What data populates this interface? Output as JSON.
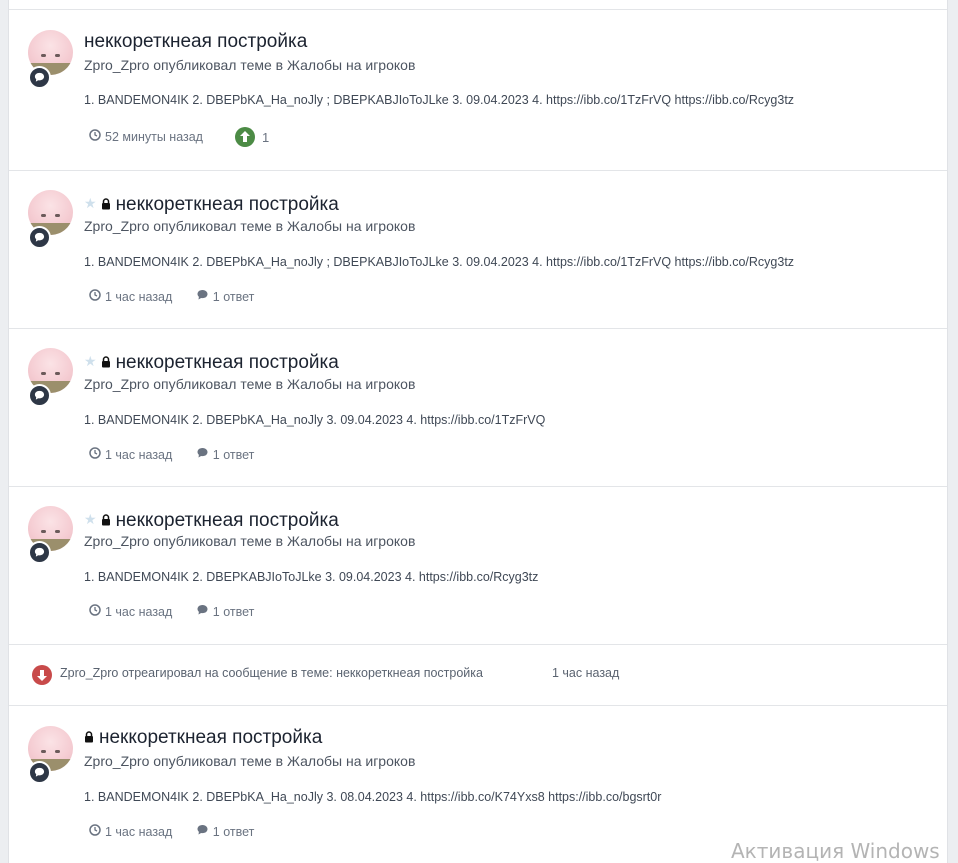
{
  "posts": [
    {
      "title": "неккореткнеая постройка",
      "starred": false,
      "locked": false,
      "meta": "Zpro_Zpro опубликовал теме в Жалобы на игроков",
      "content": "1. BANDEMON4IK 2. DBEPbKA_Ha_noJly ; DBEPKABJIoToJLke 3. 09.04.2023 4. https://ibb.co/1TzFrVQ https://ibb.co/Rcyg3tz",
      "time": "52 минуты назад",
      "reputation": "1"
    },
    {
      "title": "неккореткнеая постройка",
      "starred": true,
      "locked": true,
      "meta": "Zpro_Zpro опубликовал теме в Жалобы на игроков",
      "content": "1. BANDEMON4IK 2. DBEPbKA_Ha_noJly ; DBEPKABJIoToJLke 3. 09.04.2023 4. https://ibb.co/1TzFrVQ https://ibb.co/Rcyg3tz",
      "time": "1 час назад",
      "replies": "1 ответ"
    },
    {
      "title": "неккореткнеая постройка",
      "starred": true,
      "locked": true,
      "meta": "Zpro_Zpro опубликовал теме в Жалобы на игроков",
      "content": "1. BANDEMON4IK 2. DBEPbKA_Ha_noJly 3. 09.04.2023 4. https://ibb.co/1TzFrVQ",
      "time": "1 час назад",
      "replies": "1 ответ"
    },
    {
      "title": "неккореткнеая постройка",
      "starred": true,
      "locked": true,
      "meta": "Zpro_Zpro опубликовал теме в Жалобы на игроков",
      "content": "1. BANDEMON4IK 2. DBEPKABJIoToJLke 3. 09.04.2023 4. https://ibb.co/Rcyg3tz",
      "time": "1 час назад",
      "replies": "1 ответ"
    },
    {
      "title": "неккореткнеая постройка",
      "starred": false,
      "locked": true,
      "meta": "Zpro_Zpro опубликовал теме в Жалобы на игроков",
      "content": "1. BANDEMON4IK 2. DBEPbKA_Ha_noJly 3. 08.04.2023 4. https://ibb.co/K74Yxs8 https://ibb.co/bgsrt0r",
      "time": "1 час назад",
      "replies": "1 ответ"
    }
  ],
  "activity": {
    "text": "Zpro_Zpro отреагировал на сообщение в теме: неккореткнеая постройка",
    "time": "1 час назад"
  },
  "watermark": "Активация Windows",
  "icons": {
    "badge": "comment-icon",
    "time": "clock-icon",
    "replies": "comment-icon",
    "upvote": "arrow-up-circle-icon",
    "downvote": "arrow-down-circle-icon",
    "star": "star-icon",
    "lock": "lock-icon"
  },
  "colors": {
    "upvote": "#4c8b45",
    "downvote": "#c84a4a",
    "badge": "#2e3746"
  }
}
